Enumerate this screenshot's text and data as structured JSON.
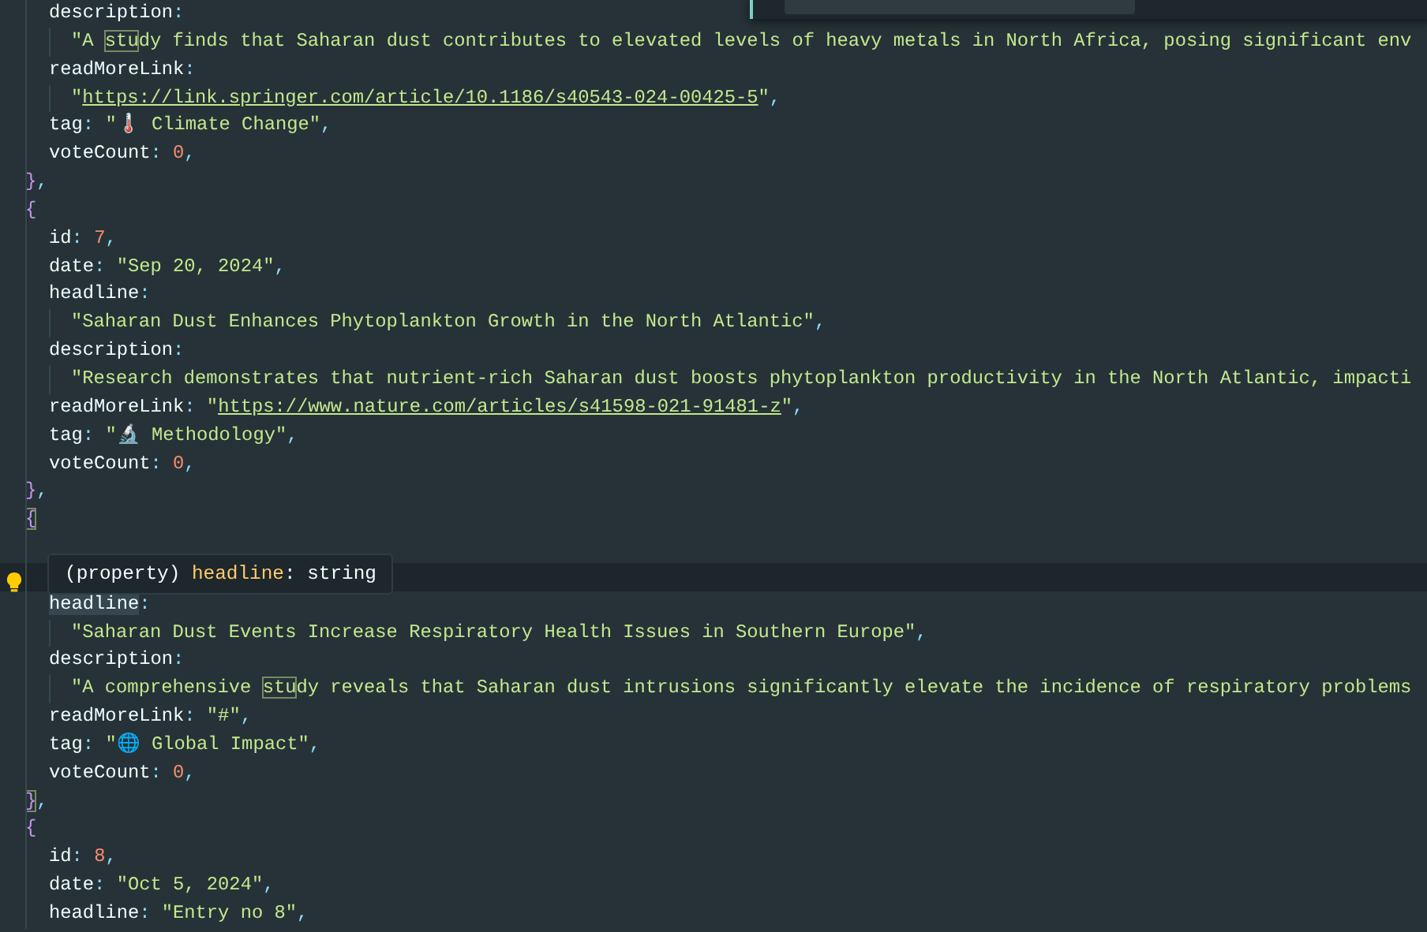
{
  "editor": {
    "lines": [
      {
        "kind": "property",
        "current": false,
        "tokens": [
          {
            "kind": "key",
            "text": "description"
          },
          {
            "kind": "punct",
            "text": ":"
          }
        ]
      },
      {
        "kind": "continuation",
        "current": false,
        "tokens": [
          {
            "kind": "string",
            "text": "\"A "
          },
          {
            "kind": "match",
            "text": "stu"
          },
          {
            "kind": "string",
            "text": "dy finds that Saharan dust contributes to elevated levels of heavy metals in North Africa, posing significant env"
          }
        ]
      },
      {
        "kind": "property",
        "current": false,
        "tokens": [
          {
            "kind": "key",
            "text": "readMoreLink"
          },
          {
            "kind": "punct",
            "text": ":"
          }
        ]
      },
      {
        "kind": "continuation",
        "current": false,
        "tokens": [
          {
            "kind": "string",
            "text": "\""
          },
          {
            "kind": "link",
            "text": "https://link.springer.com/article/10.1186/s40543-024-00425-5"
          },
          {
            "kind": "string",
            "text": "\""
          },
          {
            "kind": "punct",
            "text": ","
          }
        ]
      },
      {
        "kind": "property",
        "current": false,
        "tokens": [
          {
            "kind": "key",
            "text": "tag"
          },
          {
            "kind": "punct",
            "text": ": "
          },
          {
            "kind": "string",
            "text": "\"🌡️ Climate Change\""
          },
          {
            "kind": "punct",
            "text": ","
          }
        ]
      },
      {
        "kind": "property",
        "current": false,
        "tokens": [
          {
            "kind": "key",
            "text": "voteCount"
          },
          {
            "kind": "punct",
            "text": ": "
          },
          {
            "kind": "number",
            "text": "0"
          },
          {
            "kind": "punct",
            "text": ","
          }
        ]
      },
      {
        "kind": "object",
        "current": false,
        "tokens": [
          {
            "kind": "brace",
            "text": "}"
          },
          {
            "kind": "punct",
            "text": ","
          }
        ]
      },
      {
        "kind": "object",
        "current": false,
        "tokens": [
          {
            "kind": "brace",
            "text": "{"
          }
        ]
      },
      {
        "kind": "property",
        "current": false,
        "tokens": [
          {
            "kind": "key",
            "text": "id"
          },
          {
            "kind": "punct",
            "text": ": "
          },
          {
            "kind": "number",
            "text": "7"
          },
          {
            "kind": "punct",
            "text": ","
          }
        ]
      },
      {
        "kind": "property",
        "current": false,
        "tokens": [
          {
            "kind": "key",
            "text": "date"
          },
          {
            "kind": "punct",
            "text": ": "
          },
          {
            "kind": "string",
            "text": "\"Sep 20, 2024\""
          },
          {
            "kind": "punct",
            "text": ","
          }
        ]
      },
      {
        "kind": "property",
        "current": false,
        "tokens": [
          {
            "kind": "key",
            "text": "headline"
          },
          {
            "kind": "punct",
            "text": ":"
          }
        ]
      },
      {
        "kind": "continuation",
        "current": false,
        "tokens": [
          {
            "kind": "string",
            "text": "\"Saharan Dust Enhances Phytoplankton Growth in the North Atlantic\""
          },
          {
            "kind": "punct",
            "text": ","
          }
        ]
      },
      {
        "kind": "property",
        "current": false,
        "tokens": [
          {
            "kind": "key",
            "text": "description"
          },
          {
            "kind": "punct",
            "text": ":"
          }
        ]
      },
      {
        "kind": "continuation",
        "current": false,
        "tokens": [
          {
            "kind": "string",
            "text": "\"Research demonstrates that nutrient-rich Saharan dust boosts phytoplankton productivity in the North Atlantic, impacti"
          }
        ]
      },
      {
        "kind": "property",
        "current": false,
        "tokens": [
          {
            "kind": "key",
            "text": "readMoreLink"
          },
          {
            "kind": "punct",
            "text": ": "
          },
          {
            "kind": "string",
            "text": "\""
          },
          {
            "kind": "link",
            "text": "https://www.nature.com/articles/s41598-021-91481-z"
          },
          {
            "kind": "string",
            "text": "\""
          },
          {
            "kind": "punct",
            "text": ","
          }
        ]
      },
      {
        "kind": "property",
        "current": false,
        "tokens": [
          {
            "kind": "key",
            "text": "tag"
          },
          {
            "kind": "punct",
            "text": ": "
          },
          {
            "kind": "string",
            "text": "\"🔬 Methodology\""
          },
          {
            "kind": "punct",
            "text": ","
          }
        ]
      },
      {
        "kind": "property",
        "current": false,
        "tokens": [
          {
            "kind": "key",
            "text": "voteCount"
          },
          {
            "kind": "punct",
            "text": ": "
          },
          {
            "kind": "number",
            "text": "0"
          },
          {
            "kind": "punct",
            "text": ","
          }
        ]
      },
      {
        "kind": "object",
        "current": false,
        "tokens": [
          {
            "kind": "brace",
            "text": "}"
          },
          {
            "kind": "punct",
            "text": ","
          }
        ]
      },
      {
        "kind": "object",
        "current": false,
        "tokens": [
          {
            "kind": "brace-match",
            "text": "{"
          }
        ]
      },
      {
        "kind": "property",
        "current": false
      },
      {
        "kind": "property",
        "current": true
      },
      {
        "kind": "property",
        "current": false,
        "tokens": [
          {
            "kind": "key-highlight",
            "text": "headline"
          },
          {
            "kind": "punct",
            "text": ":"
          }
        ]
      },
      {
        "kind": "continuation",
        "current": false,
        "tokens": [
          {
            "kind": "string",
            "text": "\"Saharan Dust Events Increase Respiratory Health Issues in Southern Europe\""
          },
          {
            "kind": "punct",
            "text": ","
          }
        ]
      },
      {
        "kind": "property",
        "current": false,
        "tokens": [
          {
            "kind": "key",
            "text": "description"
          },
          {
            "kind": "punct",
            "text": ":"
          }
        ]
      },
      {
        "kind": "continuation",
        "current": false,
        "tokens": [
          {
            "kind": "string",
            "text": "\"A comprehensive "
          },
          {
            "kind": "match",
            "text": "stu"
          },
          {
            "kind": "string",
            "text": "dy reveals that Saharan dust intrusions significantly elevate the incidence of respiratory problems"
          }
        ]
      },
      {
        "kind": "property",
        "current": false,
        "tokens": [
          {
            "kind": "key",
            "text": "readMoreLink"
          },
          {
            "kind": "punct",
            "text": ": "
          },
          {
            "kind": "string",
            "text": "\"#\""
          },
          {
            "kind": "punct",
            "text": ","
          }
        ]
      },
      {
        "kind": "property",
        "current": false,
        "tokens": [
          {
            "kind": "key",
            "text": "tag"
          },
          {
            "kind": "punct",
            "text": ": "
          },
          {
            "kind": "string",
            "text": "\"🌐 Global Impact\""
          },
          {
            "kind": "punct",
            "text": ","
          }
        ]
      },
      {
        "kind": "property",
        "current": false,
        "tokens": [
          {
            "kind": "key",
            "text": "voteCount"
          },
          {
            "kind": "punct",
            "text": ": "
          },
          {
            "kind": "number",
            "text": "0"
          },
          {
            "kind": "punct",
            "text": ","
          }
        ]
      },
      {
        "kind": "object",
        "current": false,
        "tokens": [
          {
            "kind": "brace-match",
            "text": "}"
          },
          {
            "kind": "punct",
            "text": ","
          }
        ]
      },
      {
        "kind": "object",
        "current": false,
        "tokens": [
          {
            "kind": "brace",
            "text": "{"
          }
        ]
      },
      {
        "kind": "property",
        "current": false,
        "tokens": [
          {
            "kind": "key",
            "text": "id"
          },
          {
            "kind": "punct",
            "text": ": "
          },
          {
            "kind": "number",
            "text": "8"
          },
          {
            "kind": "punct",
            "text": ","
          }
        ]
      },
      {
        "kind": "property",
        "current": false,
        "tokens": [
          {
            "kind": "key",
            "text": "date"
          },
          {
            "kind": "punct",
            "text": ": "
          },
          {
            "kind": "string",
            "text": "\"Oct 5, 2024\""
          },
          {
            "kind": "punct",
            "text": ","
          }
        ]
      },
      {
        "kind": "property",
        "current": false,
        "tokens": [
          {
            "kind": "key",
            "text": "headline"
          },
          {
            "kind": "punct",
            "text": ": "
          },
          {
            "kind": "string",
            "text": "\"Entry no 8\""
          },
          {
            "kind": "punct",
            "text": ","
          }
        ]
      }
    ]
  },
  "hover": {
    "prefix": "(property) ",
    "name": "headline",
    "suffix": ": string"
  }
}
